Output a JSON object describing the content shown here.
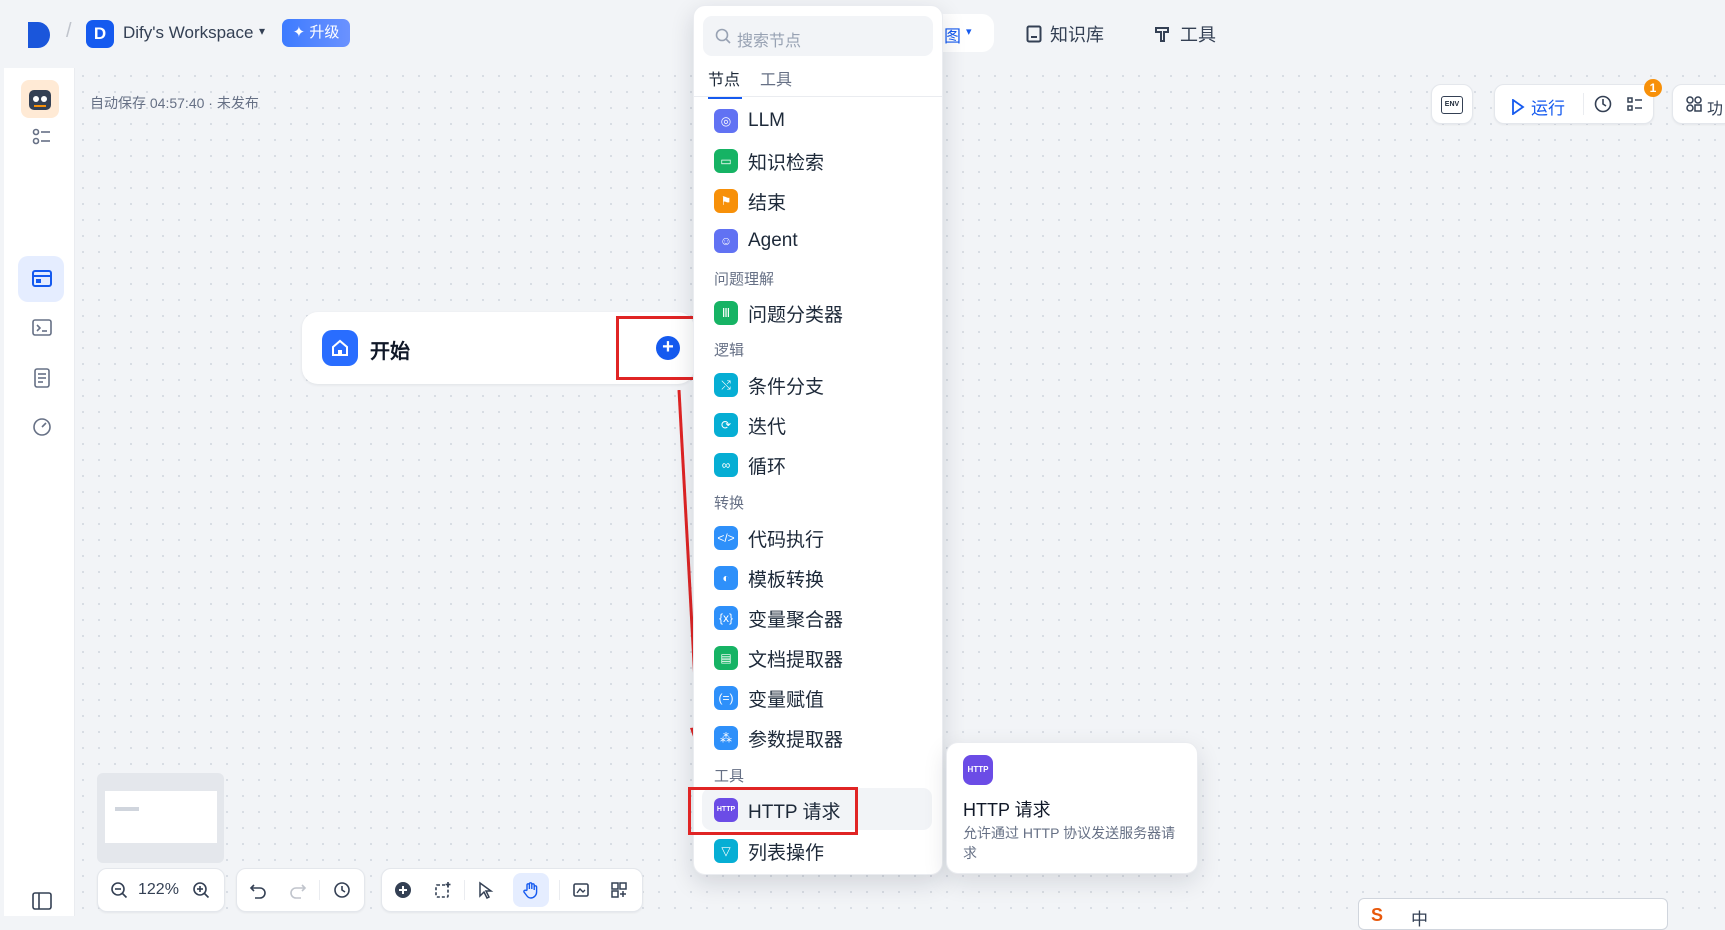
{
  "topbar": {
    "workspace_initial": "D",
    "workspace_name": "Dify's Workspace",
    "upgrade_label": "✦ 升级",
    "nav_pill_glyph": "图",
    "nav_knowledge": "知识库",
    "nav_tools": "工具"
  },
  "editor": {
    "autosave_text": "自动保存 04:57:40 · 未发布",
    "run_label": "运行",
    "env_label": "ENV",
    "notification_count": "1",
    "cut_label": "功"
  },
  "start_node": {
    "label": "开始"
  },
  "popup": {
    "search_placeholder": "搜索节点",
    "tabs": [
      "节点",
      "工具"
    ],
    "items": {
      "llm": "LLM",
      "knowledge": "知识检索",
      "end": "结束",
      "agent": "Agent",
      "sec_question": "问题理解",
      "classifier": "问题分类器",
      "sec_logic": "逻辑",
      "ifelse": "条件分支",
      "iteration": "迭代",
      "loop": "循环",
      "sec_transform": "转换",
      "code": "代码执行",
      "template": "模板转换",
      "aggregator": "变量聚合器",
      "docextract": "文档提取器",
      "assign": "变量赋值",
      "param": "参数提取器",
      "sec_tools": "工具",
      "http": "HTTP 请求",
      "listop": "列表操作"
    }
  },
  "tooltip": {
    "icon_text": "HTTP",
    "title": "HTTP 请求",
    "desc": "允许通过 HTTP 协议发送服务器请求"
  },
  "zoom": {
    "level": "122%"
  },
  "ime": {
    "chars": "中"
  },
  "colors": {
    "accent": "#155aef",
    "annotation_red": "#e02424"
  }
}
